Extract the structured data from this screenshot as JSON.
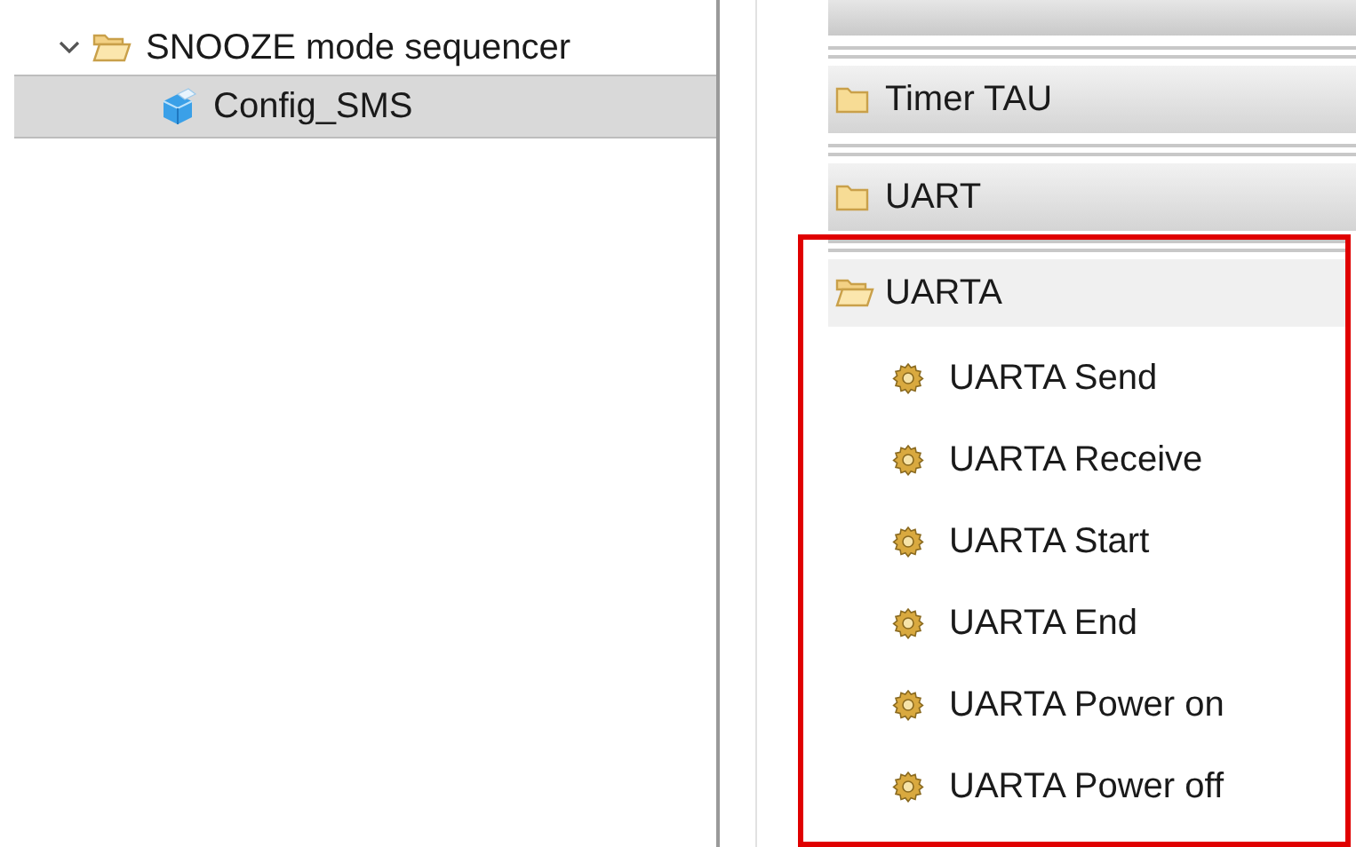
{
  "project_tree": [
    {
      "label": "SNOOZE mode sequencer",
      "expanded": true,
      "children": [
        {
          "label": "Config_SMS",
          "selected": true
        }
      ]
    }
  ],
  "palette": {
    "groups": [
      {
        "label": "Timer TAU",
        "expanded": false,
        "highlighted": false
      },
      {
        "label": "UART",
        "expanded": false,
        "highlighted": false
      },
      {
        "label": "UARTA",
        "expanded": true,
        "highlighted": true,
        "items": [
          "UARTA Send",
          "UARTA Receive",
          "UARTA Start",
          "UARTA End",
          "UARTA Power on",
          "UARTA Power off"
        ]
      }
    ]
  }
}
